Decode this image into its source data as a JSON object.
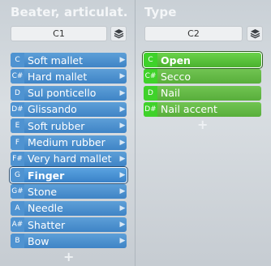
{
  "left_panel": {
    "title": "Beater, articulat.",
    "key_value": "C1",
    "stack_icon": "layers-icon",
    "items": [
      {
        "note": "C",
        "label": "Soft mallet",
        "selected": false
      },
      {
        "note": "C#",
        "label": "Hard mallet",
        "selected": false
      },
      {
        "note": "D",
        "label": "Sul ponticello",
        "selected": false
      },
      {
        "note": "D#",
        "label": "Glissando",
        "selected": false
      },
      {
        "note": "E",
        "label": "Soft rubber",
        "selected": false
      },
      {
        "note": "F",
        "label": "Medium rubber",
        "selected": false
      },
      {
        "note": "F#",
        "label": "Very hard mallet",
        "selected": false
      },
      {
        "note": "G",
        "label": "Finger",
        "selected": true
      },
      {
        "note": "G#",
        "label": "Stone",
        "selected": false
      },
      {
        "note": "A",
        "label": "Needle",
        "selected": false
      },
      {
        "note": "A#",
        "label": "Shatter",
        "selected": false
      },
      {
        "note": "B",
        "label": "Bow",
        "selected": false
      }
    ],
    "add_label": "+"
  },
  "right_panel": {
    "title": "Type",
    "key_value": "C2",
    "stack_icon": "layers-icon",
    "items": [
      {
        "note": "C",
        "label": "Open",
        "selected": true
      },
      {
        "note": "C#",
        "label": "Secco",
        "selected": false
      },
      {
        "note": "D",
        "label": "Nail",
        "selected": false
      },
      {
        "note": "D#",
        "label": "Nail accent",
        "selected": false
      }
    ],
    "add_label": "+"
  },
  "colors": {
    "left_row": "#4a8fd0",
    "right_row": "#62b844",
    "title_text": "#f4f6f8"
  }
}
